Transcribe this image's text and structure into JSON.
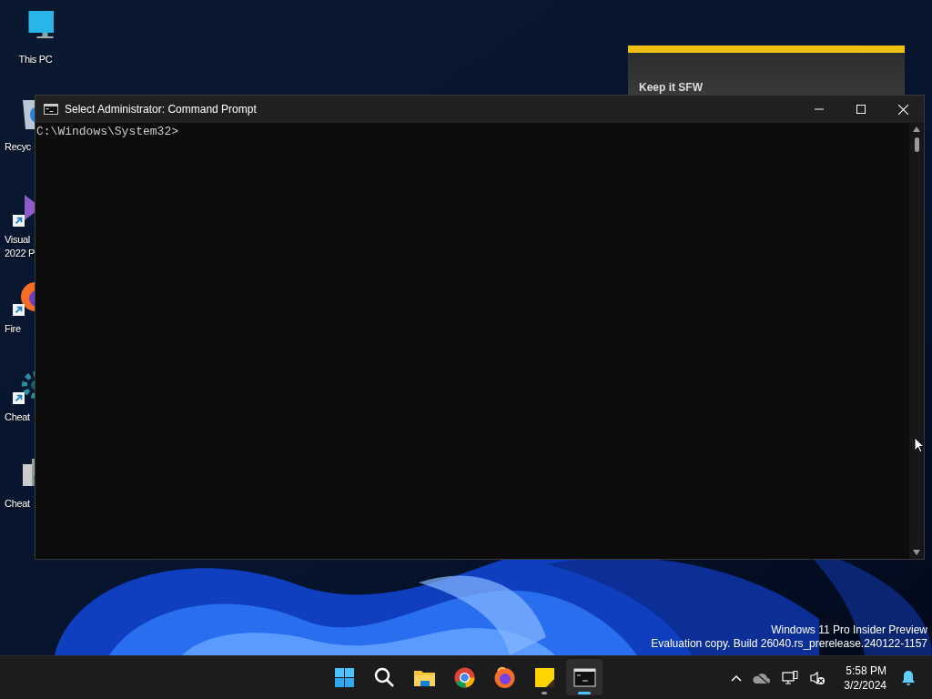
{
  "desktop_icons": [
    {
      "kind": "pc",
      "label_lines": [
        "This PC"
      ],
      "shortcut": false
    },
    {
      "kind": "recycle",
      "label_lines": [
        "Recyc"
      ],
      "shortcut": false
    },
    {
      "kind": "studio",
      "label_lines": [
        "Visual",
        "2022 P"
      ],
      "shortcut": true
    },
    {
      "kind": "firefox",
      "label_lines": [
        "Fire"
      ],
      "shortcut": true
    },
    {
      "kind": "gear",
      "label_lines": [
        "Cheat"
      ],
      "shortcut": true
    },
    {
      "kind": "tool",
      "label_lines": [
        "Cheat"
      ],
      "shortcut": false
    }
  ],
  "notification": {
    "title": "Keep it SFW"
  },
  "window": {
    "title": "Select Administrator: Command Prompt",
    "console_lines": [
      "C:\\Windows\\System32>"
    ]
  },
  "evaluation_notice": [
    "Windows 11 Pro Insider Preview",
    "Evaluation copy. Build 26040.rs_prerelease.240122-1157"
  ],
  "taskbar": {
    "apps": [
      {
        "kind": "start",
        "running": false,
        "active": false
      },
      {
        "kind": "search",
        "running": false,
        "active": false
      },
      {
        "kind": "explorer",
        "running": false,
        "active": false
      },
      {
        "kind": "chrome",
        "running": false,
        "active": false
      },
      {
        "kind": "firefox",
        "running": false,
        "active": false
      },
      {
        "kind": "notes",
        "running": true,
        "active": false
      },
      {
        "kind": "cmd",
        "running": true,
        "active": true
      }
    ],
    "tray": {
      "time": "5:58 PM",
      "date": "3/2/2024"
    }
  }
}
